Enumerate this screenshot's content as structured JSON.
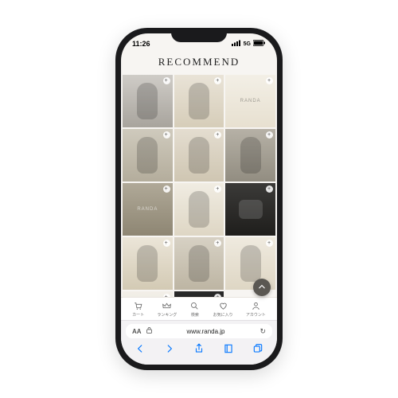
{
  "status": {
    "time": "11:26",
    "network": "5G"
  },
  "header": {
    "title": "RECOMMEND"
  },
  "brand": "RANDA",
  "tiles": [
    {
      "overlay": ""
    },
    {
      "overlay": ""
    },
    {
      "overlay": "RANDA"
    },
    {
      "overlay": ""
    },
    {
      "overlay": ""
    },
    {
      "overlay": ""
    },
    {
      "overlay": "RANDA"
    },
    {
      "overlay": ""
    },
    {
      "overlay": ""
    },
    {
      "overlay": ""
    },
    {
      "overlay": ""
    },
    {
      "overlay": ""
    },
    {
      "overlay": ""
    },
    {
      "overlay": ""
    }
  ],
  "app_tabs": {
    "cart": "カート",
    "ranking": "ランキング",
    "search": "検索",
    "favorite": "お気に入り",
    "account": "アカウント"
  },
  "safari": {
    "font_label": "AA",
    "url": "www.randa.jp",
    "reload": "↻"
  }
}
